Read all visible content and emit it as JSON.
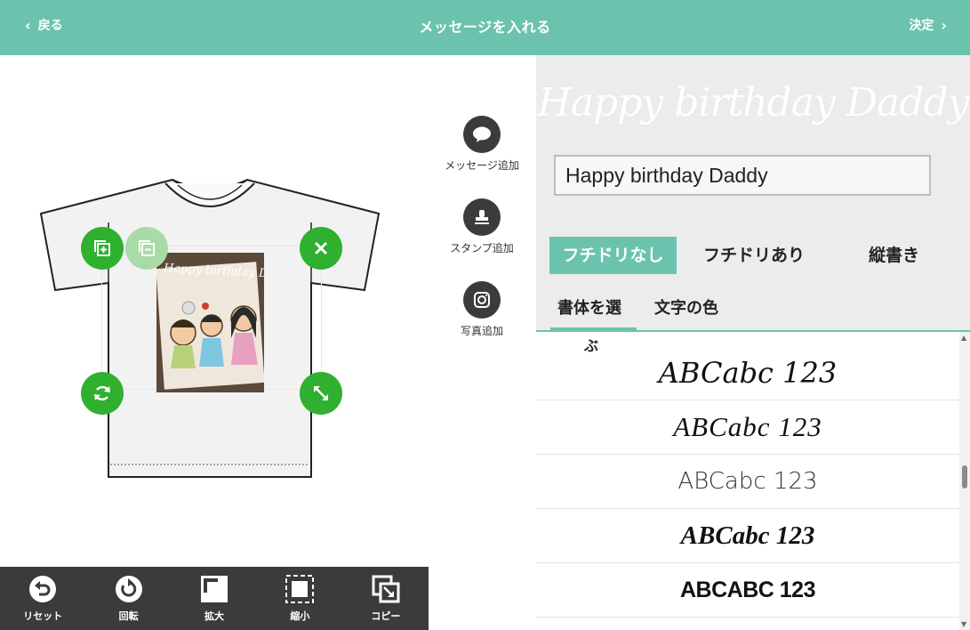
{
  "header": {
    "back_label": "戻る",
    "title": "メッセージを入れる",
    "confirm_label": "決定"
  },
  "side_buttons": [
    {
      "label": "メッセージ追加",
      "icon": "speech-bubble-icon"
    },
    {
      "label": "スタンプ追加",
      "icon": "stamp-icon"
    },
    {
      "label": "写真追加",
      "icon": "camera-icon"
    }
  ],
  "canvas": {
    "photo_caption": "Happy birthday Daddy",
    "handles": [
      "duplicate-icon",
      "minus-icon",
      "close-icon",
      "rotate-icon",
      "resize-icon"
    ]
  },
  "toolbar": [
    {
      "label": "リセット",
      "icon": "undo-icon"
    },
    {
      "label": "回転",
      "icon": "rotate-icon"
    },
    {
      "label": "拡大",
      "icon": "enlarge-icon"
    },
    {
      "label": "縮小",
      "icon": "shrink-icon"
    },
    {
      "label": "コピー",
      "icon": "copy-icon"
    }
  ],
  "panel": {
    "preview_text": "Happy birthday Daddy",
    "input_value": "Happy birthday Daddy",
    "outline_options": [
      {
        "label": "フチドリなし",
        "active": true
      },
      {
        "label": "フチドリあり",
        "active": false
      },
      {
        "label": "縦書き",
        "active": false
      }
    ],
    "subtabs": [
      {
        "label": "書体を選",
        "active": true
      },
      {
        "label": "文字の色",
        "active": false
      }
    ],
    "stray_char": "ぶ",
    "font_samples": [
      "ABCabc 123",
      "ABCabc 123",
      "ABCabc 123",
      "ABCabc 123",
      "ABCABC 123"
    ]
  },
  "colors": {
    "accent": "#6bc3ad",
    "handle_green": "#2fb02f",
    "toolbar_bg": "#3b3b3b",
    "panel_bg": "#ececec"
  }
}
